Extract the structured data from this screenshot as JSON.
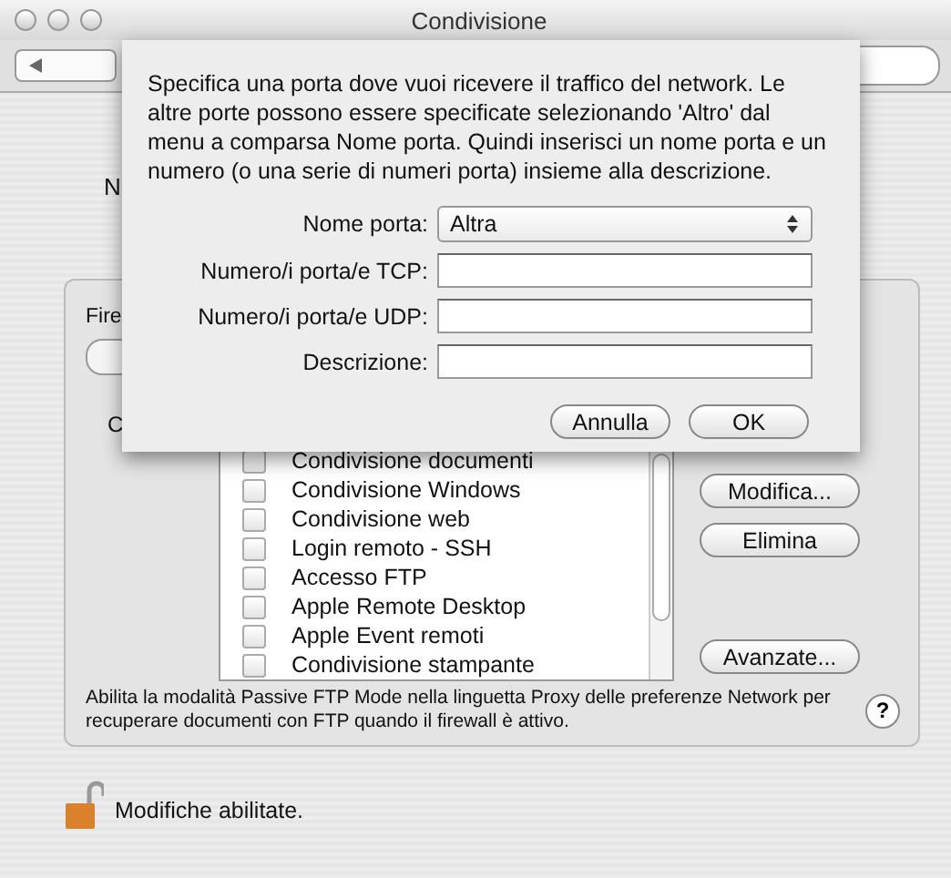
{
  "window": {
    "title": "Condivisione"
  },
  "background": {
    "fragment_1": "N",
    "group_label": "Fire",
    "fragment_2": "C"
  },
  "sheet": {
    "message": "Specifica una porta dove vuoi ricevere il traffico del network. Le altre porte possono essere specificate selezionando 'Altro' dal menu a comparsa Nome porta. Quindi inserisci un nome porta e un numero (o una serie di numeri porta) insieme alla descrizione.",
    "fields": [
      {
        "label": "Nome porta:",
        "kind": "popup",
        "value": "Altra"
      },
      {
        "label": "Numero/i porta/e TCP:",
        "kind": "text"
      },
      {
        "label": "Numero/i porta/e UDP:",
        "kind": "text"
      },
      {
        "label": "Descrizione:",
        "kind": "text"
      }
    ],
    "buttons": [
      "Annulla",
      "OK"
    ]
  },
  "services": [
    {
      "label": "Condivisione documenti",
      "checked": false
    },
    {
      "label": "Condivisione Windows",
      "checked": false
    },
    {
      "label": "Condivisione web",
      "checked": false
    },
    {
      "label": "Login remoto - SSH",
      "checked": false
    },
    {
      "label": "Accesso FTP",
      "checked": false
    },
    {
      "label": "Apple Remote Desktop",
      "checked": false
    },
    {
      "label": "Apple Event remoti",
      "checked": false
    },
    {
      "label": "Condivisione stampante",
      "checked": false
    }
  ],
  "edit_buttons": [
    "Modifica...",
    "Elimina"
  ],
  "advanced_button": "Avanzate...",
  "note": "Abilita la modalità Passive FTP Mode nella linguetta Proxy delle preferenze Network per recuperare documenti con FTP quando il firewall è attivo.",
  "help_button": "?",
  "lock": {
    "label": "Modifiche abilitate.",
    "locked": false
  }
}
